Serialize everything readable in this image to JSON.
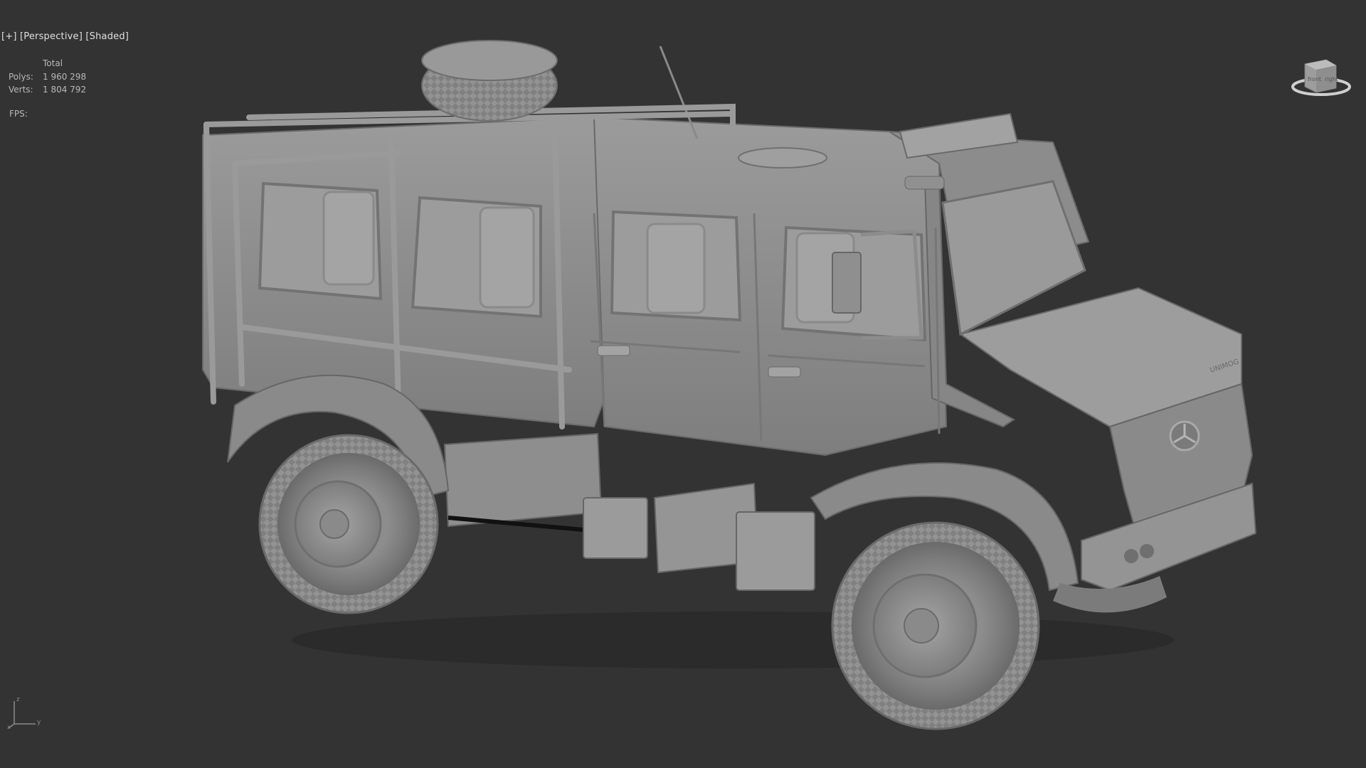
{
  "viewport": {
    "menu_plus": "[+]",
    "menu_view": "[Perspective]",
    "menu_shading": "[Shaded]"
  },
  "stats": {
    "header": "Total",
    "rows": [
      {
        "label": "Polys:",
        "value": "1 960 298"
      },
      {
        "label": "Verts:",
        "value": "1 804 792"
      }
    ],
    "fps_label": "FPS:"
  },
  "viewcube": {
    "front_label": "front",
    "right_label": "right"
  },
  "axis": {
    "z": "z",
    "y": "y",
    "x": "x"
  },
  "model": {
    "badge_text": "UNIMOG",
    "colors": {
      "background": "#333333",
      "body": "#8e8e8e",
      "body_light": "#a6a6a6",
      "body_dark": "#6f6f6f",
      "tire": "#8a8a8a",
      "window": "#9a9a9a"
    }
  }
}
